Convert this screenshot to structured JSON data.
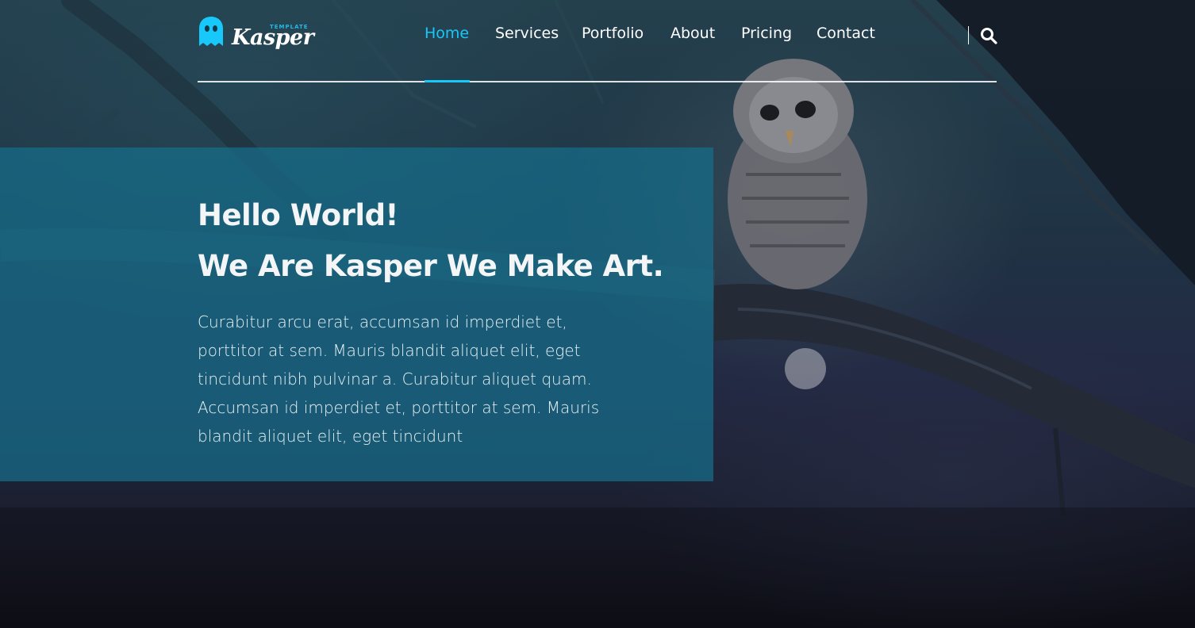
{
  "brand": {
    "logo_small": "TEMPLATE",
    "logo_name": "Kasper",
    "accent_color": "#19c8fa",
    "logo_icon": "ghost-icon"
  },
  "nav": {
    "items": [
      {
        "label": "Home",
        "active": true
      },
      {
        "label": "Services",
        "active": false
      },
      {
        "label": "Portfolio",
        "active": false
      },
      {
        "label": "About",
        "active": false
      },
      {
        "label": "Pricing",
        "active": false
      },
      {
        "label": "Contact",
        "active": false
      }
    ],
    "search_icon": "search-icon"
  },
  "hero": {
    "heading_line1": "Hello World!",
    "heading_line2": "We Are Kasper We Make Art.",
    "paragraph_lines": [
      "Curabitur arcu erat, accumsan id imperdiet et,",
      "porttitor at sem. Mauris blandit aliquet elit, eget",
      "tincidunt nibh pulvinar a. Curabitur aliquet quam.",
      "Accumsan id imperdiet et, porttitor at sem. Mauris",
      "blandit aliquet elit, eget tincidunt"
    ],
    "panel_color": "#166e8a",
    "background_image": "owl-on-branch"
  }
}
